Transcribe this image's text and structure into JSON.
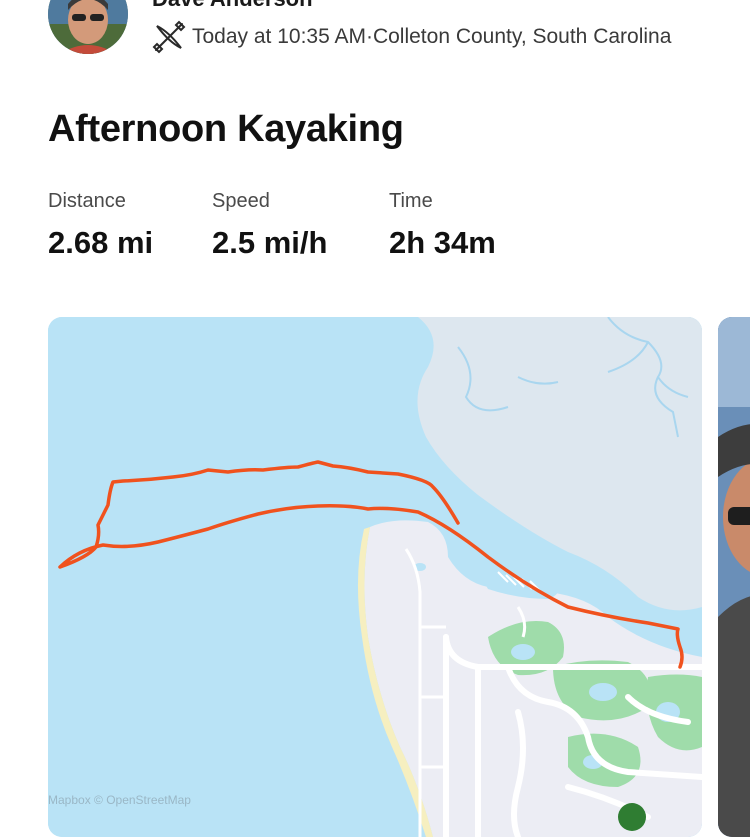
{
  "athlete": {
    "name": "Dave Anderson"
  },
  "activity": {
    "sport_icon": "kayak-icon",
    "date_time": "Today at 10:35 AM",
    "separator": " · ",
    "location": "Colleton County, South Carolina",
    "title": "Afternoon Kayaking"
  },
  "stats": [
    {
      "label": "Distance",
      "value": "2.68 mi"
    },
    {
      "label": "Speed",
      "value": "2.5 mi/h"
    },
    {
      "label": "Time",
      "value": "2h 34m"
    }
  ],
  "map": {
    "attribution": "Mapbox © OpenStreetMap",
    "route_color": "#f0521e",
    "water_color": "#b9e3f6",
    "land_color": "#ecedf4",
    "park_color": "#9fdcaa"
  }
}
